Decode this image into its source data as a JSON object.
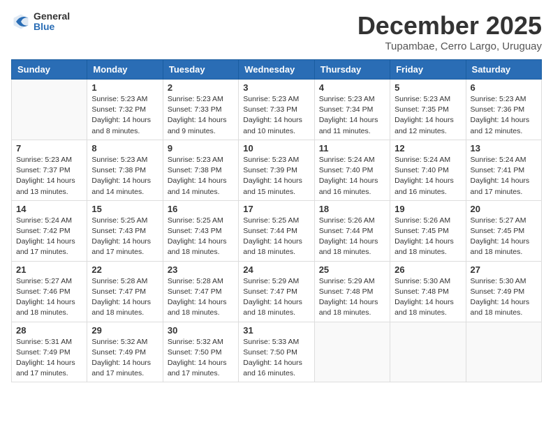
{
  "header": {
    "logo_general": "General",
    "logo_blue": "Blue",
    "month_title": "December 2025",
    "subtitle": "Tupambae, Cerro Largo, Uruguay"
  },
  "weekdays": [
    "Sunday",
    "Monday",
    "Tuesday",
    "Wednesday",
    "Thursday",
    "Friday",
    "Saturday"
  ],
  "weeks": [
    [
      {
        "day": "",
        "info": ""
      },
      {
        "day": "1",
        "info": "Sunrise: 5:23 AM\nSunset: 7:32 PM\nDaylight: 14 hours\nand 8 minutes."
      },
      {
        "day": "2",
        "info": "Sunrise: 5:23 AM\nSunset: 7:33 PM\nDaylight: 14 hours\nand 9 minutes."
      },
      {
        "day": "3",
        "info": "Sunrise: 5:23 AM\nSunset: 7:33 PM\nDaylight: 14 hours\nand 10 minutes."
      },
      {
        "day": "4",
        "info": "Sunrise: 5:23 AM\nSunset: 7:34 PM\nDaylight: 14 hours\nand 11 minutes."
      },
      {
        "day": "5",
        "info": "Sunrise: 5:23 AM\nSunset: 7:35 PM\nDaylight: 14 hours\nand 12 minutes."
      },
      {
        "day": "6",
        "info": "Sunrise: 5:23 AM\nSunset: 7:36 PM\nDaylight: 14 hours\nand 12 minutes."
      }
    ],
    [
      {
        "day": "7",
        "info": "Sunrise: 5:23 AM\nSunset: 7:37 PM\nDaylight: 14 hours\nand 13 minutes."
      },
      {
        "day": "8",
        "info": "Sunrise: 5:23 AM\nSunset: 7:38 PM\nDaylight: 14 hours\nand 14 minutes."
      },
      {
        "day": "9",
        "info": "Sunrise: 5:23 AM\nSunset: 7:38 PM\nDaylight: 14 hours\nand 14 minutes."
      },
      {
        "day": "10",
        "info": "Sunrise: 5:23 AM\nSunset: 7:39 PM\nDaylight: 14 hours\nand 15 minutes."
      },
      {
        "day": "11",
        "info": "Sunrise: 5:24 AM\nSunset: 7:40 PM\nDaylight: 14 hours\nand 16 minutes."
      },
      {
        "day": "12",
        "info": "Sunrise: 5:24 AM\nSunset: 7:40 PM\nDaylight: 14 hours\nand 16 minutes."
      },
      {
        "day": "13",
        "info": "Sunrise: 5:24 AM\nSunset: 7:41 PM\nDaylight: 14 hours\nand 17 minutes."
      }
    ],
    [
      {
        "day": "14",
        "info": "Sunrise: 5:24 AM\nSunset: 7:42 PM\nDaylight: 14 hours\nand 17 minutes."
      },
      {
        "day": "15",
        "info": "Sunrise: 5:25 AM\nSunset: 7:43 PM\nDaylight: 14 hours\nand 17 minutes."
      },
      {
        "day": "16",
        "info": "Sunrise: 5:25 AM\nSunset: 7:43 PM\nDaylight: 14 hours\nand 18 minutes."
      },
      {
        "day": "17",
        "info": "Sunrise: 5:25 AM\nSunset: 7:44 PM\nDaylight: 14 hours\nand 18 minutes."
      },
      {
        "day": "18",
        "info": "Sunrise: 5:26 AM\nSunset: 7:44 PM\nDaylight: 14 hours\nand 18 minutes."
      },
      {
        "day": "19",
        "info": "Sunrise: 5:26 AM\nSunset: 7:45 PM\nDaylight: 14 hours\nand 18 minutes."
      },
      {
        "day": "20",
        "info": "Sunrise: 5:27 AM\nSunset: 7:45 PM\nDaylight: 14 hours\nand 18 minutes."
      }
    ],
    [
      {
        "day": "21",
        "info": "Sunrise: 5:27 AM\nSunset: 7:46 PM\nDaylight: 14 hours\nand 18 minutes."
      },
      {
        "day": "22",
        "info": "Sunrise: 5:28 AM\nSunset: 7:47 PM\nDaylight: 14 hours\nand 18 minutes."
      },
      {
        "day": "23",
        "info": "Sunrise: 5:28 AM\nSunset: 7:47 PM\nDaylight: 14 hours\nand 18 minutes."
      },
      {
        "day": "24",
        "info": "Sunrise: 5:29 AM\nSunset: 7:47 PM\nDaylight: 14 hours\nand 18 minutes."
      },
      {
        "day": "25",
        "info": "Sunrise: 5:29 AM\nSunset: 7:48 PM\nDaylight: 14 hours\nand 18 minutes."
      },
      {
        "day": "26",
        "info": "Sunrise: 5:30 AM\nSunset: 7:48 PM\nDaylight: 14 hours\nand 18 minutes."
      },
      {
        "day": "27",
        "info": "Sunrise: 5:30 AM\nSunset: 7:49 PM\nDaylight: 14 hours\nand 18 minutes."
      }
    ],
    [
      {
        "day": "28",
        "info": "Sunrise: 5:31 AM\nSunset: 7:49 PM\nDaylight: 14 hours\nand 17 minutes."
      },
      {
        "day": "29",
        "info": "Sunrise: 5:32 AM\nSunset: 7:49 PM\nDaylight: 14 hours\nand 17 minutes."
      },
      {
        "day": "30",
        "info": "Sunrise: 5:32 AM\nSunset: 7:50 PM\nDaylight: 14 hours\nand 17 minutes."
      },
      {
        "day": "31",
        "info": "Sunrise: 5:33 AM\nSunset: 7:50 PM\nDaylight: 14 hours\nand 16 minutes."
      },
      {
        "day": "",
        "info": ""
      },
      {
        "day": "",
        "info": ""
      },
      {
        "day": "",
        "info": ""
      }
    ]
  ]
}
